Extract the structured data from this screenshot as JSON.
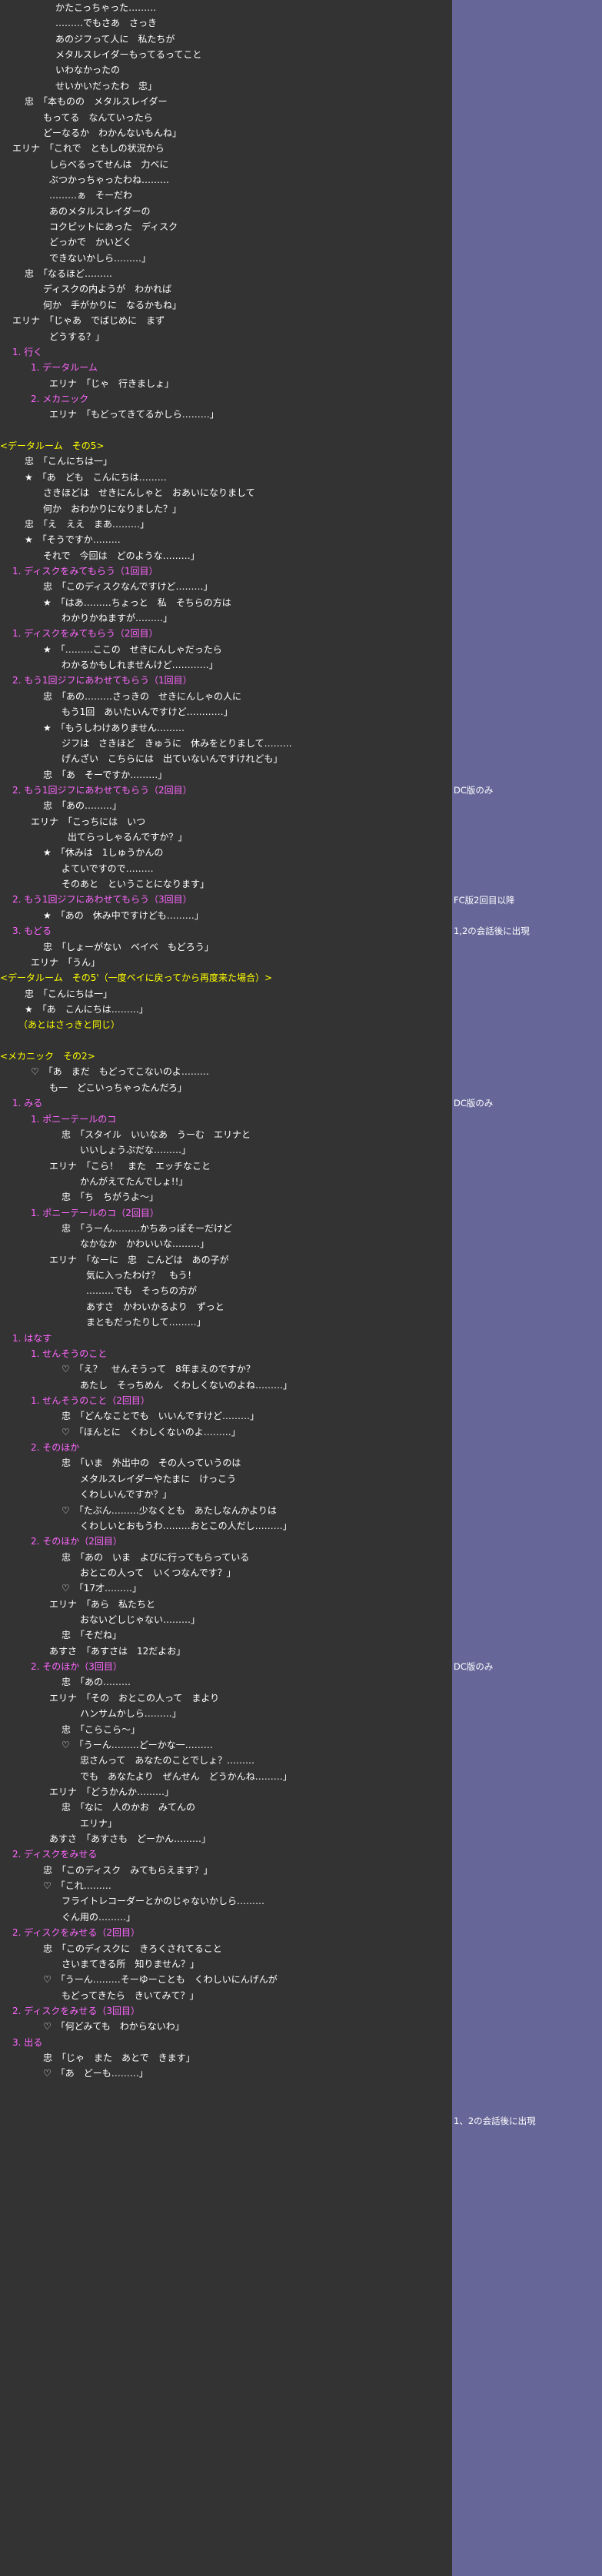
{
  "colors": {
    "background": "#333333",
    "side_column": "#666699",
    "text": "#ffffff",
    "choice": "#ff66ff",
    "scene_header": "#ffff00",
    "dialogue": "#ffffff"
  },
  "script_lines": [
    {
      "indent": 9,
      "color": "w",
      "text": "かたこっちゃった………"
    },
    {
      "indent": 9,
      "color": "w",
      "text": "………でもさあ　さっき"
    },
    {
      "indent": 9,
      "color": "w",
      "text": "あのジフって人に　私たちが"
    },
    {
      "indent": 9,
      "color": "w",
      "text": "メタルスレイダーもってるってこと"
    },
    {
      "indent": 9,
      "color": "w",
      "text": "いわなかったの"
    },
    {
      "indent": 9,
      "color": "w",
      "text": "せいかいだったわ　忠」"
    },
    {
      "indent": 4,
      "color": "w",
      "text": "忠　「本ものの　メタルスレイダー"
    },
    {
      "indent": 7,
      "color": "w",
      "text": "もってる　なんていったら"
    },
    {
      "indent": 7,
      "color": "w",
      "text": "どーなるか　わかんないもんね」"
    },
    {
      "indent": 2,
      "color": "w",
      "text": "エリナ　「これで　ともしの状況から"
    },
    {
      "indent": 8,
      "color": "w",
      "text": "しらべるってせんは　力ベに"
    },
    {
      "indent": 8,
      "color": "w",
      "text": "ぶつかっちゃったわね………"
    },
    {
      "indent": 8,
      "color": "w",
      "text": "………ぁ　そーだわ"
    },
    {
      "indent": 8,
      "color": "w",
      "text": "あのメタルスレイダーの"
    },
    {
      "indent": 8,
      "color": "w",
      "text": "コクピットにあった　ディスク"
    },
    {
      "indent": 8,
      "color": "w",
      "text": "どっかで　かいどく"
    },
    {
      "indent": 8,
      "color": "w",
      "text": "できないかしら………」"
    },
    {
      "indent": 4,
      "color": "w",
      "text": "忠　「なるほど………"
    },
    {
      "indent": 7,
      "color": "w",
      "text": "ディスクの内ようが　わかれば"
    },
    {
      "indent": 7,
      "color": "w",
      "text": "何か　手がかりに　なるかもね」"
    },
    {
      "indent": 2,
      "color": "w",
      "text": "エリナ　「じゃあ　でばじめに　まず"
    },
    {
      "indent": 8,
      "color": "w",
      "text": "どうする？」"
    },
    {
      "indent": 2,
      "color": "p",
      "text": "1. 行く"
    },
    {
      "indent": 5,
      "color": "p",
      "text": "1. データルーム"
    },
    {
      "indent": 8,
      "color": "w",
      "text": "エリナ　「じゃ　行きましょ」"
    },
    {
      "indent": 5,
      "color": "p",
      "text": "2. メカニック"
    },
    {
      "indent": 8,
      "color": "w",
      "text": "エリナ　「もどってきてるかしら………」"
    },
    {
      "indent": 0,
      "color": "w",
      "text": ""
    },
    {
      "indent": 0,
      "color": "y",
      "text": "<データルーム　その5>"
    },
    {
      "indent": 4,
      "color": "w",
      "text": "忠　「こんにちは一」"
    },
    {
      "indent": 4,
      "color": "w",
      "text": "★　「あ　ども　こんにちは………"
    },
    {
      "indent": 7,
      "color": "w",
      "text": "さきほどは　せきにんしゃと　おあいになりまして"
    },
    {
      "indent": 7,
      "color": "w",
      "text": "何か　おわかりになりました？」"
    },
    {
      "indent": 4,
      "color": "w",
      "text": "忠　「え　ええ　まあ………」"
    },
    {
      "indent": 4,
      "color": "w",
      "text": "★　「そうですか………"
    },
    {
      "indent": 7,
      "color": "w",
      "text": "それで　今回は　どのような………」"
    },
    {
      "indent": 2,
      "color": "p",
      "text": "1. ディスクをみてもらう（1回目）"
    },
    {
      "indent": 7,
      "color": "w",
      "text": "忠　「このディスクなんですけど………」"
    },
    {
      "indent": 7,
      "color": "w",
      "text": "★　「はあ………ちょっと　私　そちらの方は"
    },
    {
      "indent": 10,
      "color": "w",
      "text": "わかりかねますが………」"
    },
    {
      "indent": 2,
      "color": "p",
      "text": "1. ディスクをみてもらう（2回目）"
    },
    {
      "indent": 7,
      "color": "w",
      "text": "★　「………ここの　せきにんしゃだったら"
    },
    {
      "indent": 10,
      "color": "w",
      "text": "わかるかもしれませんけど…………」"
    },
    {
      "indent": 2,
      "color": "p",
      "text": "2. もう1回ジフにあわせてもらう（1回目）"
    },
    {
      "indent": 7,
      "color": "w",
      "text": "忠　「あの………さっきの　せきにんしゃの人に"
    },
    {
      "indent": 10,
      "color": "w",
      "text": "もう1回　あいたいんですけど…………」"
    },
    {
      "indent": 7,
      "color": "w",
      "text": "★　「もうしわけありません………"
    },
    {
      "indent": 10,
      "color": "w",
      "text": "ジフは　さきほど　きゅうに　休みをとりまして………"
    },
    {
      "indent": 10,
      "color": "w",
      "text": "げんざい　こちらには　出ていないんですけれども」"
    },
    {
      "indent": 7,
      "color": "w",
      "text": "忠　「あ　そーですか………」"
    },
    {
      "indent": 2,
      "color": "p",
      "text": "2. もう1回ジフにあわせてもらう（2回目）"
    },
    {
      "indent": 7,
      "color": "w",
      "text": "忠　「あの………」"
    },
    {
      "indent": 5,
      "color": "w",
      "text": "エリナ　「こっちには　いつ"
    },
    {
      "indent": 11,
      "color": "w",
      "text": "出てらっしゃるんですか？」"
    },
    {
      "indent": 7,
      "color": "w",
      "text": "★　「休みは　1しゅうかんの"
    },
    {
      "indent": 10,
      "color": "w",
      "text": "よていですので………"
    },
    {
      "indent": 10,
      "color": "w",
      "text": "そのあと　ということになります」"
    },
    {
      "indent": 2,
      "color": "p",
      "text": "2. もう1回ジフにあわせてもらう（3回目）"
    },
    {
      "indent": 7,
      "color": "w",
      "text": "★　「あの　休み中ですけども………」"
    },
    {
      "indent": 2,
      "color": "p",
      "text": "3. もどる"
    },
    {
      "indent": 7,
      "color": "w",
      "text": "忠　「しょーがない　ベイベ　もどろう」"
    },
    {
      "indent": 5,
      "color": "w",
      "text": "エリナ　「うん」"
    },
    {
      "indent": 0,
      "color": "y",
      "text": "<データルーム　その5'（一度ベイに戻ってから再度来た場合）>"
    },
    {
      "indent": 4,
      "color": "w",
      "text": "忠　「こんにちは一」"
    },
    {
      "indent": 4,
      "color": "w",
      "text": "★　「あ　こんにちは………」"
    },
    {
      "indent": 3,
      "color": "y",
      "text": "（あとはさっきと同じ）"
    },
    {
      "indent": 0,
      "color": "w",
      "text": ""
    },
    {
      "indent": 0,
      "color": "y",
      "text": "<メカニック　その2>"
    },
    {
      "indent": 5,
      "color": "w",
      "text": "♡　「あ　まだ　もどってこないのよ………"
    },
    {
      "indent": 8,
      "color": "w",
      "text": "も一　どこいっちゃったんだろ」"
    },
    {
      "indent": 2,
      "color": "p",
      "text": "1. みる"
    },
    {
      "indent": 5,
      "color": "p",
      "text": "1. ポニーテールのコ"
    },
    {
      "indent": 10,
      "color": "w",
      "text": "忠　「スタイル　いいなあ　うーむ　エリナと"
    },
    {
      "indent": 13,
      "color": "w",
      "text": "いいしょうぶだな………」"
    },
    {
      "indent": 8,
      "color": "w",
      "text": "エリナ　「こら！　また　エッチなこと"
    },
    {
      "indent": 13,
      "color": "w",
      "text": "かんがえてたんでしょ!!」"
    },
    {
      "indent": 10,
      "color": "w",
      "text": "忠　「ち　ちがうよ～」"
    },
    {
      "indent": 5,
      "color": "p",
      "text": "1. ポニーテールのコ（2回目）"
    },
    {
      "indent": 10,
      "color": "w",
      "text": "忠　「うーん………かちあっぽそーだけど"
    },
    {
      "indent": 13,
      "color": "w",
      "text": "なかなか　かわいいな………」"
    },
    {
      "indent": 8,
      "color": "w",
      "text": "エリナ　「なーに　忠　こんどは　あの子が"
    },
    {
      "indent": 14,
      "color": "w",
      "text": "気に入ったわけ？　もう！"
    },
    {
      "indent": 14,
      "color": "w",
      "text": "………でも　そっちの方が"
    },
    {
      "indent": 14,
      "color": "w",
      "text": "あすさ　かわいかるより　ずっと"
    },
    {
      "indent": 14,
      "color": "w",
      "text": "まともだったりして………」"
    },
    {
      "indent": 2,
      "color": "p",
      "text": "1. はなす"
    },
    {
      "indent": 5,
      "color": "p",
      "text": "1. せんそうのこと"
    },
    {
      "indent": 10,
      "color": "w",
      "text": "♡　「え？　せんそうって　8年まえのですか？"
    },
    {
      "indent": 13,
      "color": "w",
      "text": "あたし　そっちめん　くわしくないのよね………」"
    },
    {
      "indent": 5,
      "color": "p",
      "text": "1. せんそうのこと（2回目）"
    },
    {
      "indent": 10,
      "color": "w",
      "text": "忠　「どんなことでも　いいんですけど………」"
    },
    {
      "indent": 10,
      "color": "w",
      "text": "♡　「ほんとに　くわしくないのよ………」"
    },
    {
      "indent": 5,
      "color": "p",
      "text": "2. そのほか"
    },
    {
      "indent": 10,
      "color": "w",
      "text": "忠　「いま　外出中の　その人っていうのは"
    },
    {
      "indent": 13,
      "color": "w",
      "text": "メタルスレイダーやたまに　けっこう"
    },
    {
      "indent": 13,
      "color": "w",
      "text": "くわしいんですか？」"
    },
    {
      "indent": 10,
      "color": "w",
      "text": "♡　「たぶん………少なくとも　あたしなんかよりは"
    },
    {
      "indent": 13,
      "color": "w",
      "text": "くわしいとおもうわ………おとこの人だし………」"
    },
    {
      "indent": 5,
      "color": "p",
      "text": "2. そのほか（2回目）"
    },
    {
      "indent": 10,
      "color": "w",
      "text": "忠　「あの　いま　よびに行ってもらっている"
    },
    {
      "indent": 13,
      "color": "w",
      "text": "おとこの人って　いくつなんです？」"
    },
    {
      "indent": 10,
      "color": "w",
      "text": "♡　「17才………」"
    },
    {
      "indent": 8,
      "color": "w",
      "text": "エリナ　「あら　私たちと"
    },
    {
      "indent": 13,
      "color": "w",
      "text": "おないどしじゃない………」"
    },
    {
      "indent": 10,
      "color": "w",
      "text": "忠　「そだね」"
    },
    {
      "indent": 8,
      "color": "w",
      "text": "あすさ　「あすさは　12だよお」"
    },
    {
      "indent": 5,
      "color": "p",
      "text": "2. そのほか（3回目）"
    },
    {
      "indent": 10,
      "color": "w",
      "text": "忠　「あの………"
    },
    {
      "indent": 8,
      "color": "w",
      "text": "エリナ　「その　おとこの人って　まより"
    },
    {
      "indent": 13,
      "color": "w",
      "text": "ハンサムかしら………」"
    },
    {
      "indent": 10,
      "color": "w",
      "text": "忠　「こらこら～」"
    },
    {
      "indent": 10,
      "color": "w",
      "text": "♡　「うーん………どーかな一………"
    },
    {
      "indent": 13,
      "color": "w",
      "text": "忠さんって　あなたのことでしょ？………"
    },
    {
      "indent": 13,
      "color": "w",
      "text": "でも　あなたより　ぜんせん　どうかんね………」"
    },
    {
      "indent": 8,
      "color": "w",
      "text": "エリナ　「どうかんか………」"
    },
    {
      "indent": 10,
      "color": "w",
      "text": "忠　「なに　人のかお　みてんの"
    },
    {
      "indent": 13,
      "color": "w",
      "text": "エリナ」"
    },
    {
      "indent": 8,
      "color": "w",
      "text": "あすさ　「あすさも　どーかん………」"
    },
    {
      "indent": 2,
      "color": "p",
      "text": "2. ディスクをみせる"
    },
    {
      "indent": 7,
      "color": "w",
      "text": "忠　「このディスク　みてもらえます？」"
    },
    {
      "indent": 7,
      "color": "w",
      "text": "♡　「これ………"
    },
    {
      "indent": 10,
      "color": "w",
      "text": "フライトレコーダーとかのじゃないかしら………"
    },
    {
      "indent": 10,
      "color": "w",
      "text": "ぐん用の………」"
    },
    {
      "indent": 2,
      "color": "p",
      "text": "2. ディスクをみせる（2回目）"
    },
    {
      "indent": 7,
      "color": "w",
      "text": "忠　「このディスクに　きろくされてること"
    },
    {
      "indent": 10,
      "color": "w",
      "text": "さいまてきる所　知りません？」"
    },
    {
      "indent": 7,
      "color": "w",
      "text": "♡　「うーん………そーゆーことも　くわしいにんげんが"
    },
    {
      "indent": 10,
      "color": "w",
      "text": "もどってきたら　きいてみて？」"
    },
    {
      "indent": 2,
      "color": "p",
      "text": "2. ディスクをみせる（3回目）"
    },
    {
      "indent": 7,
      "color": "w",
      "text": "♡　「何どみても　わからないわ」"
    },
    {
      "indent": 2,
      "color": "p",
      "text": "3. 出る"
    },
    {
      "indent": 7,
      "color": "w",
      "text": "忠　「じゃ　また　あとで　きます」"
    },
    {
      "indent": 7,
      "color": "w",
      "text": "♡　「あ　どーも………」"
    }
  ],
  "side_notes": [
    {
      "line": 50,
      "text": "DC版のみ"
    },
    {
      "line": 57,
      "text": "FC版2回目以降"
    },
    {
      "line": 59,
      "text": "1,2の会話後に出現"
    },
    {
      "line": 70,
      "text": "DC版のみ"
    },
    {
      "line": 106,
      "text": "DC版のみ"
    },
    {
      "line": 135,
      "text": "1、2の会話後に出現"
    }
  ]
}
